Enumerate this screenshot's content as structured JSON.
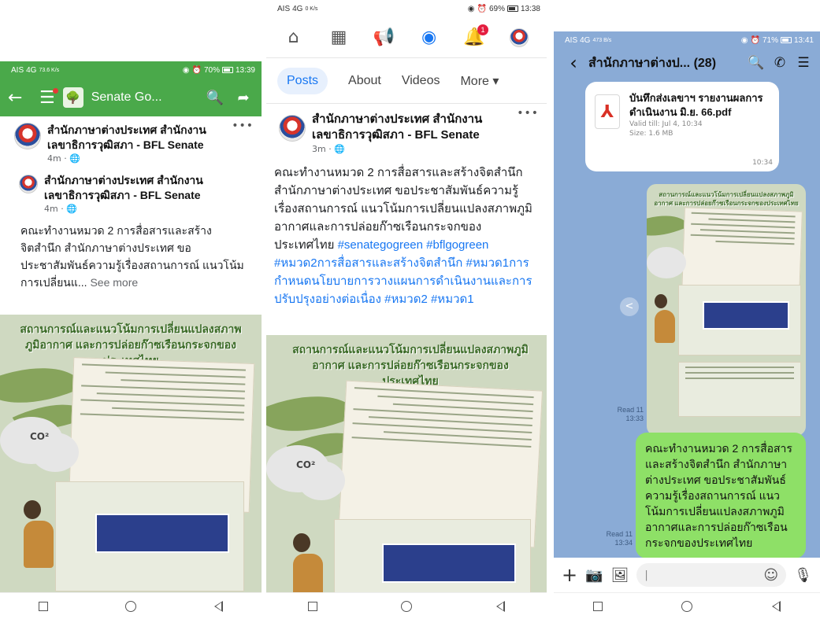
{
  "phone1": {
    "status": {
      "carrier": "AIS",
      "net": "4G",
      "speed": "73.6 K/s",
      "battery": "70%",
      "time": "13:39"
    },
    "appbar": {
      "back": "←",
      "menu": "☰",
      "title": "Senate Go...",
      "search": "🔍",
      "share": "➦"
    },
    "posts": [
      {
        "name": "สำนักภาษาต่างประเทศ สำนักงานเลขาธิการวุฒิสภา - BFL Senate",
        "meta": "4m · 🌐",
        "more": "•••"
      },
      {
        "name": "สำนักภาษาต่างประเทศ สำนักงานเลขาธิการวุฒิสภา - BFL Senate",
        "meta": "4m · 🌐"
      }
    ],
    "text": "คณะทำงานหมวด 2 การสื่อสารและสร้างจิตสำนึก สำนักภาษาต่างประเทศ ขอประชาสัมพันธ์ความรู้เรื่องสถานการณ์ แนวโน้มการเปลี่ยนแ...",
    "see_more": "See more",
    "poster_title": "สถานการณ์และแนวโน้มการเปลี่ยนแปลงสภาพภูมิอากาศ และการปล่อยก๊าซเรือนกระจกของประเทศไทย"
  },
  "phone2": {
    "status": {
      "carrier": "AIS",
      "net": "4G",
      "speed": "0 K/s",
      "battery": "69%",
      "time": "13:38"
    },
    "nav": {
      "home": "⌂",
      "pages": "▦",
      "megaphone": "📢",
      "profile": "◉",
      "bell": "🔔",
      "badge": "1"
    },
    "tabs": [
      "Posts",
      "About",
      "Videos",
      "More ▾"
    ],
    "post": {
      "name": "สำนักภาษาต่างประเทศ สำนักงานเลขาธิการวุฒิสภา - BFL Senate",
      "meta": "3m · 🌐",
      "more": "•••"
    },
    "text_plain": "คณะทำงานหมวด 2 การสื่อสารและสร้างจิตสำนึก สำนักภาษาต่างประเทศ ขอประชาสัมพันธ์ความรู้เรื่องสถานการณ์ แนวโน้มการเปลี่ยนแปลงสภาพภูมิอากาศและการปล่อยก๊าซเรือนกระจกของประเทศไทย ",
    "text_hashtags": "#senategogreen #bflgogreen #หมวด2การสื่อสารและสร้างจิตสำนึก #หมวด1การกำหนดนโยบายการวางแผนการดำเนินงานและการปรับปรุงอย่างต่อเนื่อง #หมวด2 #หมวด1",
    "poster_title": "สถานการณ์และแนวโน้มการเปลี่ยนแปลงสภาพภูมิอากาศ และการปล่อยก๊าซเรือนกระจกของประเทศไทย"
  },
  "phone3": {
    "status": {
      "carrier": "AIS",
      "net": "4G",
      "speed": "473 B/s",
      "battery": "71%",
      "time": "13:41"
    },
    "header": {
      "back": "‹",
      "title": "สำนักภาษาต่างป... (28)",
      "search": "🔍",
      "call": "✆",
      "menu": "☰"
    },
    "file": {
      "name": "บันทึกส่งเลขาฯ รายงานผลการดำเนินงาน มิ.ย. 66.pdf",
      "valid": "Valid till: Jul 4, 10:34",
      "size": "Size: 1.6 MB",
      "time": "10:34"
    },
    "read1": {
      "label": "Read 11",
      "time": "13:33"
    },
    "read2": {
      "label": "Read 11",
      "time": "13:34"
    },
    "message": "คณะทำงานหมวด 2 การสื่อสารและสร้างจิตสำนึก สำนักภาษาต่างประเทศ ขอประชาสัมพันธ์ความรู้เรื่องสถานการณ์ แนวโน้มการเปลี่ยนแปลงสภาพภูมิอากาศและการปล่อยก๊าซเรือนกระจกของประเทศไทย",
    "input": {
      "plus": "+",
      "camera": "📷",
      "image": "🖼",
      "emoji": "☺",
      "mic": "🎙"
    },
    "poster_title": "สถานการณ์และแนวโน้มการเปลี่ยนแปลงสภาพภูมิอากาศ และการปล่อยก๊าซเรือนกระจกของประเทศไทย"
  },
  "colors": {
    "fb_blue": "#1877f2",
    "app_green": "#4aa94a",
    "line_bubble": "#8ee067",
    "chat_bg": "#8aabd6"
  }
}
